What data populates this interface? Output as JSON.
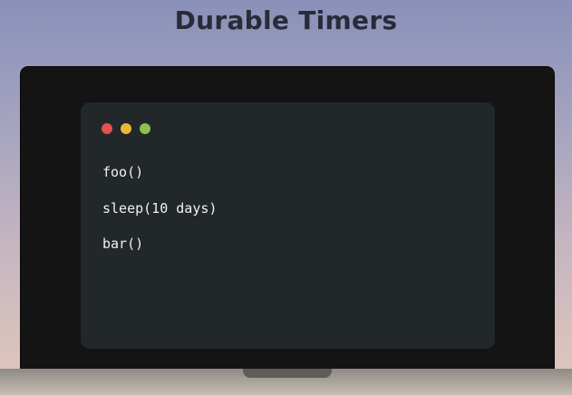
{
  "title": "Durable Timers",
  "window": {
    "controls": [
      {
        "name": "close-dot",
        "color": "#e2524a"
      },
      {
        "name": "minimize-dot",
        "color": "#e9b838"
      },
      {
        "name": "maximize-dot",
        "color": "#8cc150"
      }
    ],
    "code_lines": [
      "foo()",
      "sleep(10 days)",
      "bar()"
    ]
  }
}
